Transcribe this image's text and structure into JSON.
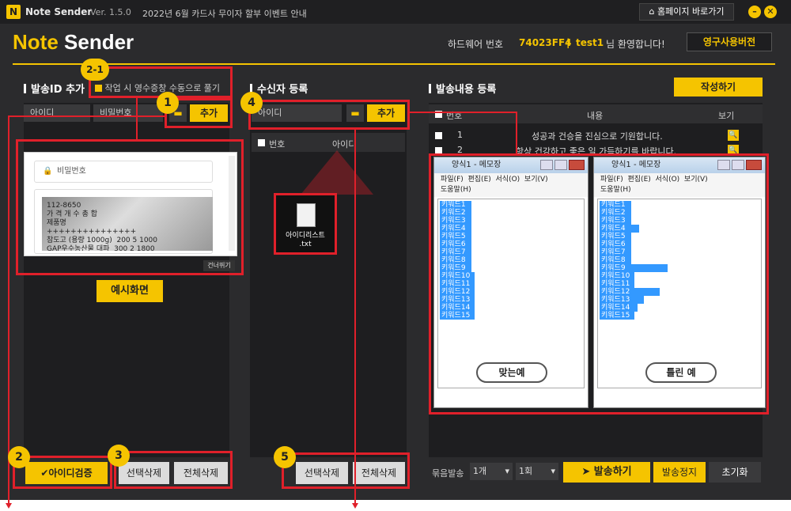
{
  "titlebar": {
    "logo_letter": "N",
    "app_name": "Note Sender",
    "version": "Ver. 1.5.0",
    "notice": "2022년 6월 카드사 무이자 할부 이벤트 안내",
    "home_button": "홈페이지 바로가기"
  },
  "header": {
    "brand_part1": "Note",
    "brand_part2": "Sender",
    "hw_label": "하드웨어 번호",
    "hw_value": "74023FF4",
    "separator": "|",
    "user": "test1",
    "welcome": "님 환영합니다!",
    "perm_button": "영구사용버전"
  },
  "sender_panel": {
    "title": "발송ID 추가",
    "manual_toggle": "작업 시 영수증창 수동으로 풀기",
    "col_id": "아이디",
    "col_pw": "비밀번호",
    "add_button": "추가",
    "preview_field": "비밀번호",
    "preview_receipt": "112-8650\n가 격 개 수 총 합\n제품명\n+++++++++++++++\n참도고 (용량 1000g)  200 5 1000\nGAP우수농산물 대파  300 2 1800\n즉석밥 냉면  200 5 1000",
    "preview_skip": "건너뛰기",
    "example_label": "예시화면",
    "verify_button": "✔아이디검증",
    "delete_selected": "선택삭제",
    "delete_all": "전체삭제"
  },
  "recipient_panel": {
    "title": "수신자 등록",
    "col_id": "아이디",
    "add_button": "추가",
    "col_num": "번호",
    "col_id2": "아이디",
    "file_name": "아이디리스트\n.txt",
    "delete_selected": "선택삭제",
    "delete_all": "전체삭제"
  },
  "content_panel": {
    "title": "발송내용 등록",
    "write_button": "작성하기",
    "col_num": "번호",
    "col_content": "내용",
    "col_view": "보기",
    "rows": [
      {
        "num": "1",
        "text": "성공과 건승을 진심으로 기원합니다."
      },
      {
        "num": "2",
        "text": "항상 건강하고 좋은 일 가득하기를 바랍니다."
      }
    ],
    "bundle_label": "묶음발송",
    "bundle_count": "1개",
    "times": "1회",
    "send_button": "발송하기",
    "stop_button": "발송정지",
    "reset_button": "초기화"
  },
  "notepad": {
    "title": "양식1 - 메모장",
    "menu": [
      "파일(F)",
      "편집(E)",
      "서식(O)",
      "보기(V)",
      "도움말(H)"
    ],
    "keywords": [
      "키워드1",
      "키워드2",
      "키워드3",
      "키워드4",
      "키워드5",
      "키워드6",
      "키워드7",
      "키워드8",
      "키워드9",
      "키워드10",
      "키워드11",
      "키워드12",
      "키워드13",
      "키워드14",
      "키워드15"
    ],
    "correct_label": "맞는예",
    "wrong_label": "틀린 예"
  },
  "annotations": {
    "n1": "1",
    "n2_1": "2-1",
    "n2": "2",
    "n3": "3",
    "n4": "4",
    "n5": "5"
  }
}
